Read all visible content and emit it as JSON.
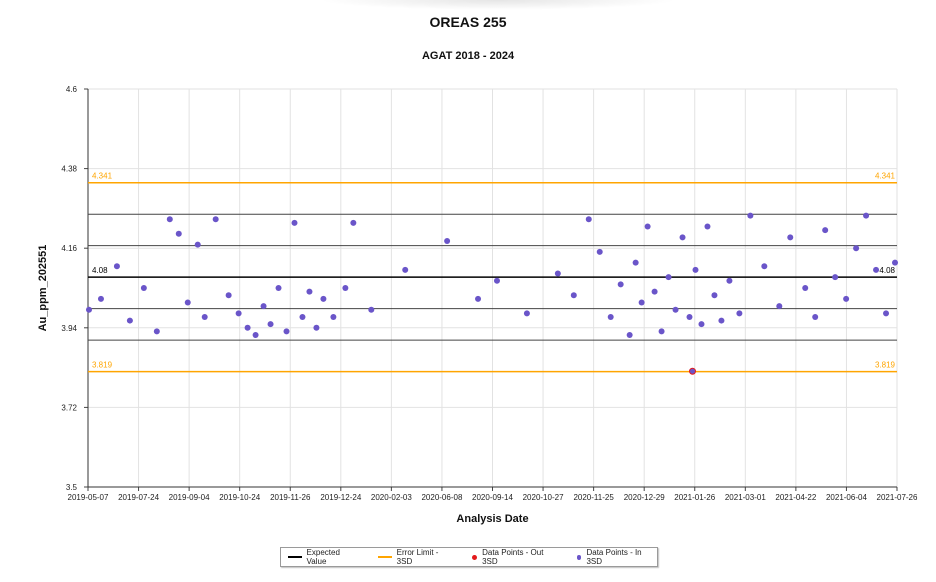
{
  "chart_data": {
    "type": "scatter",
    "title": "OREAS 255",
    "subtitle": "AGAT 2018 - 2024",
    "xlabel": "Analysis Date",
    "ylabel": "Au_ppm_202551",
    "ylim": [
      3.5,
      4.6
    ],
    "yticks": [
      "3.5",
      "3.72",
      "3.94",
      "4.16",
      "4.38",
      "4.6"
    ],
    "xlim": [
      "2019-05-07",
      "2021-07-26"
    ],
    "xticks": [
      "2019-05-07",
      "2019-07-24",
      "2019-09-04",
      "2019-10-24",
      "2019-11-26",
      "2019-12-24",
      "2020-02-03",
      "2020-06-08",
      "2020-09-14",
      "2020-10-27",
      "2020-11-25",
      "2020-12-29",
      "2021-01-26",
      "2021-03-01",
      "2021-04-22",
      "2021-06-04",
      "2021-07-26"
    ],
    "grid": true,
    "legend_position": "bottom",
    "expected_value": 4.08,
    "expected_label": "4.08",
    "error_limit_upper": 4.341,
    "error_limit_upper_label": "4.341",
    "error_limit_lower": 3.819,
    "error_limit_lower_label": "3.819",
    "sd_lines": [
      4.254,
      4.167,
      3.993,
      3.906
    ],
    "colors": {
      "expected": "#000000",
      "error_limit": "#ffa500",
      "out_3sd": "#e31a1c",
      "in_3sd": "#6a55c9",
      "sd_lines": "#444444"
    },
    "series": [
      {
        "name": "Data Points - In 3SD",
        "points": [
          [
            "2019-05-08",
            3.99
          ],
          [
            "2019-05-20",
            4.02
          ],
          [
            "2019-06-05",
            4.11
          ],
          [
            "2019-06-18",
            3.96
          ],
          [
            "2019-07-02",
            4.05
          ],
          [
            "2019-07-15",
            3.93
          ],
          [
            "2019-07-28",
            4.24
          ],
          [
            "2019-08-06",
            4.2
          ],
          [
            "2019-08-15",
            4.01
          ],
          [
            "2019-08-25",
            4.17
          ],
          [
            "2019-09-01",
            3.97
          ],
          [
            "2019-09-12",
            4.24
          ],
          [
            "2019-09-25",
            4.03
          ],
          [
            "2019-10-05",
            3.98
          ],
          [
            "2019-10-14",
            3.94
          ],
          [
            "2019-10-22",
            3.92
          ],
          [
            "2019-10-30",
            4.0
          ],
          [
            "2019-11-06",
            3.95
          ],
          [
            "2019-11-14",
            4.05
          ],
          [
            "2019-11-22",
            3.93
          ],
          [
            "2019-11-30",
            4.23
          ],
          [
            "2019-12-08",
            3.97
          ],
          [
            "2019-12-15",
            4.04
          ],
          [
            "2019-12-22",
            3.94
          ],
          [
            "2019-12-29",
            4.02
          ],
          [
            "2020-01-08",
            3.97
          ],
          [
            "2020-01-20",
            4.05
          ],
          [
            "2020-01-28",
            4.23
          ],
          [
            "2020-02-15",
            3.99
          ],
          [
            "2020-03-20",
            4.1
          ],
          [
            "2020-05-01",
            4.18
          ],
          [
            "2020-06-01",
            4.02
          ],
          [
            "2020-06-20",
            4.07
          ],
          [
            "2020-07-20",
            3.98
          ],
          [
            "2020-08-20",
            4.09
          ],
          [
            "2020-09-05",
            4.03
          ],
          [
            "2020-09-20",
            4.24
          ],
          [
            "2020-10-01",
            4.15
          ],
          [
            "2020-10-12",
            3.97
          ],
          [
            "2020-10-22",
            4.06
          ],
          [
            "2020-10-31",
            3.92
          ],
          [
            "2020-11-06",
            4.12
          ],
          [
            "2020-11-12",
            4.01
          ],
          [
            "2020-11-18",
            4.22
          ],
          [
            "2020-11-25",
            4.04
          ],
          [
            "2020-12-02",
            3.93
          ],
          [
            "2020-12-09",
            4.08
          ],
          [
            "2020-12-16",
            3.99
          ],
          [
            "2020-12-23",
            4.19
          ],
          [
            "2020-12-30",
            3.97
          ],
          [
            "2021-01-05",
            4.1
          ],
          [
            "2021-01-11",
            3.95
          ],
          [
            "2021-01-17",
            4.22
          ],
          [
            "2021-01-24",
            4.03
          ],
          [
            "2021-01-31",
            3.96
          ],
          [
            "2021-02-08",
            4.07
          ],
          [
            "2021-02-18",
            3.98
          ],
          [
            "2021-03-01",
            4.25
          ],
          [
            "2021-03-15",
            4.11
          ],
          [
            "2021-03-30",
            4.0
          ],
          [
            "2021-04-10",
            4.19
          ],
          [
            "2021-04-25",
            4.05
          ],
          [
            "2021-05-05",
            3.97
          ],
          [
            "2021-05-15",
            4.21
          ],
          [
            "2021-05-25",
            4.08
          ],
          [
            "2021-06-05",
            4.02
          ],
          [
            "2021-06-15",
            4.16
          ],
          [
            "2021-06-25",
            4.25
          ],
          [
            "2021-07-05",
            4.1
          ],
          [
            "2021-07-15",
            3.98
          ],
          [
            "2021-07-24",
            4.12
          ]
        ]
      },
      {
        "name": "Data Points - Out 3SD",
        "points": [
          [
            "2021-01-02",
            3.82
          ]
        ]
      }
    ]
  },
  "legend": {
    "expected_label": "Expected Value",
    "error_label": "Error Limit - 3SD",
    "out_label": "Data Points - Out 3SD",
    "in_label": "Data Points - In 3SD"
  }
}
